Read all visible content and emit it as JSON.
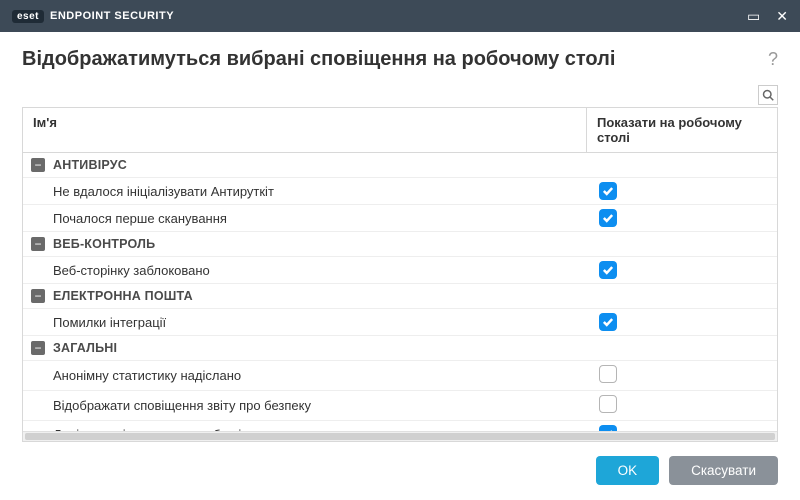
{
  "titlebar": {
    "brand": "eset",
    "product": "ENDPOINT SECURITY"
  },
  "header": {
    "title": "Відображатимуться вибрані сповіщення на робочому столі"
  },
  "columns": {
    "name": "Ім'я",
    "show": "Показати на робочому столі"
  },
  "groups": [
    {
      "label": "АНТИВІРУС",
      "items": [
        {
          "label": "Не вдалося ініціалізувати Антируткіт",
          "checked": true
        },
        {
          "label": "Почалося перше сканування",
          "checked": true
        }
      ]
    },
    {
      "label": "ВЕБ-КОНТРОЛЬ",
      "items": [
        {
          "label": "Веб-сторінку заблоковано",
          "checked": true
        }
      ]
    },
    {
      "label": "ЕЛЕКТРОННА ПОШТА",
      "items": [
        {
          "label": "Помилки інтеграції",
          "checked": true
        }
      ]
    },
    {
      "label": "ЗАГАЛЬНІ",
      "items": [
        {
          "label": "Анонімну статистику надіслано",
          "checked": false
        },
        {
          "label": "Відображати сповіщення звіту про безпеку",
          "checked": false
        },
        {
          "label": "Дані не надіслано до служби підтримки",
          "checked": true
        }
      ]
    }
  ],
  "footer": {
    "ok": "OK",
    "cancel": "Скасувати"
  }
}
